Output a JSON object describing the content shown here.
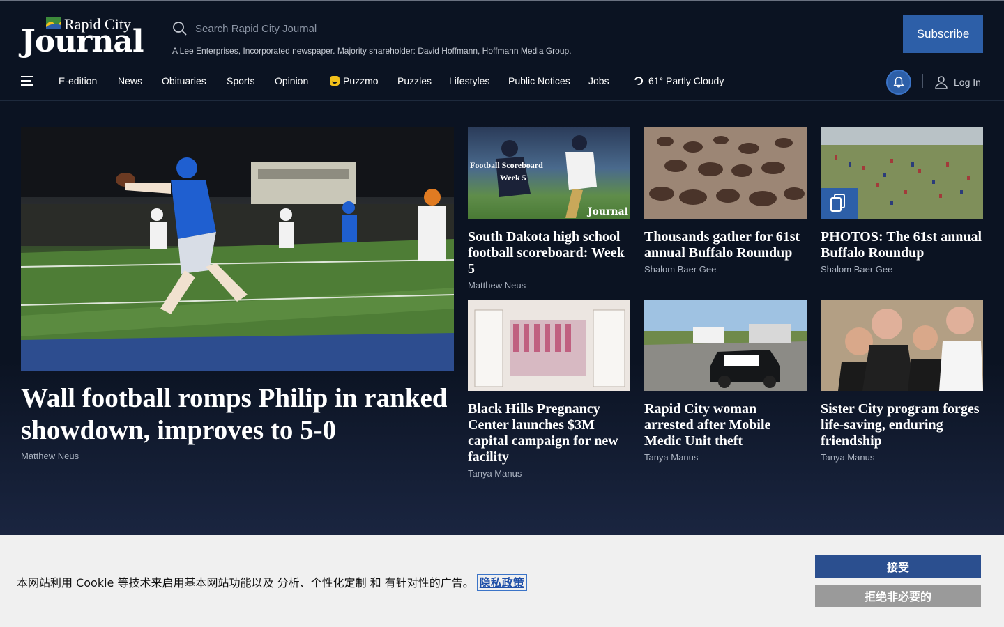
{
  "header": {
    "logo_city": "Rapid City",
    "logo_journal": "Journal",
    "search_placeholder": "Search Rapid City Journal",
    "tagline": "A Lee Enterprises, Incorporated newspaper. Majority shareholder: David Hoffmann, Hoffmann Media Group.",
    "subscribe_label": "Subscribe"
  },
  "nav": {
    "items": [
      "E-edition",
      "News",
      "Obituaries",
      "Sports",
      "Opinion",
      "Puzzmo",
      "Puzzles",
      "Lifestyles",
      "Public Notices",
      "Jobs"
    ],
    "weather": "61° Partly Cloudy",
    "login_label": "Log In"
  },
  "hero": {
    "title": "Wall football romps Philip in ranked showdown, improves to 5-0",
    "author": "Matthew Neus"
  },
  "cards": [
    {
      "title": "South Dakota high school football scoreboard: Week 5",
      "author": "Matthew Neus",
      "overlay_line1": "Football Scoreboard",
      "overlay_line2": "Week 5",
      "overlay_brand": "Journal"
    },
    {
      "title": "Thousands gather for 61st annual Buffalo Roundup",
      "author": "Shalom Baer Gee"
    },
    {
      "title": "PHOTOS: The 61st annual Buffalo Roundup",
      "author": "Shalom Baer Gee"
    },
    {
      "title": "Black Hills Pregnancy Center launches $3M capital campaign for new facility",
      "author": "Tanya Manus"
    },
    {
      "title": "Rapid City woman arrested after Mobile Medic Unit theft",
      "author": "Tanya Manus"
    },
    {
      "title": "Sister City program forges life-saving, enduring friendship",
      "author": "Tanya Manus"
    }
  ],
  "cookie": {
    "text": "本网站利用 Cookie 等技术来启用基本网站功能以及 分析、个性化定制 和 有针对性的广告。",
    "privacy_link": "隐私政策",
    "accept_label": "接受",
    "reject_label": "拒绝非必要的"
  },
  "colors": {
    "background": "#0b1322",
    "accent": "#2d5fa8",
    "cookie_bg": "#f0f0f0"
  }
}
